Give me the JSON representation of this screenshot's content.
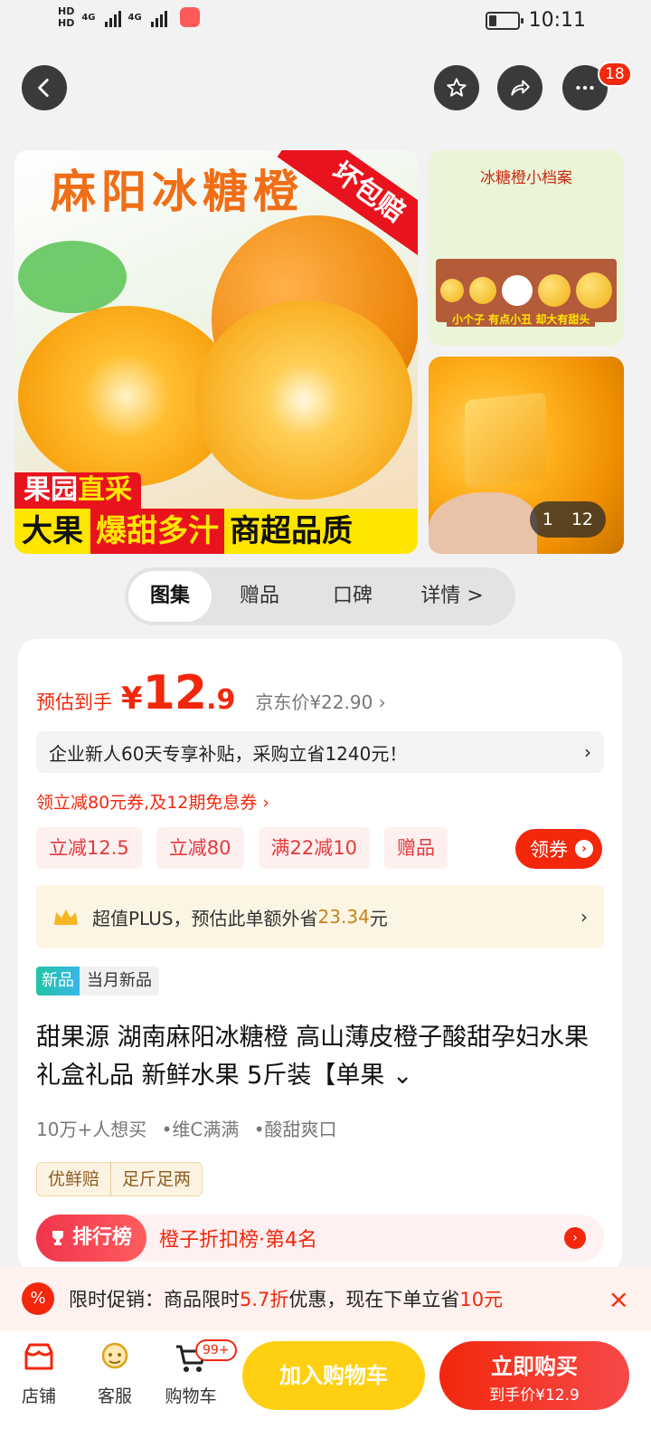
{
  "status_bar": {
    "hd1": "HD",
    "hd2": "HD",
    "net1": "4G",
    "net2": "4G",
    "time": "10:11"
  },
  "top_nav": {
    "notification_count": "18"
  },
  "gallery": {
    "main_title": "麻阳冰糖橙",
    "corner_label": "坏包赔",
    "tag_prefix": "果园",
    "tag_highlight": "直采",
    "bottom_a": "大果",
    "bottom_b": "爆甜多汁",
    "bottom_c": "商超品质",
    "side_title": "冰糖橙小档案",
    "side_caption": "小个子 有点小丑 却大有甜头",
    "page_current": "1",
    "page_total": "12"
  },
  "tabs": [
    "图集",
    "赠品",
    "口碑",
    "详情 >"
  ],
  "price": {
    "label": "预估到手",
    "symbol": "¥",
    "integer": "12",
    "decimal": ".9",
    "jd_price": "京东价¥22.90 ›"
  },
  "notice": {
    "text": "企业新人60天专享补贴，采购立省1240元！",
    "arrow": "›"
  },
  "coupon_line": "领立减80元券,及12期免息券 ›",
  "chips": [
    "立减12.5",
    "立减80",
    "满22减10",
    "赠品"
  ],
  "coupon_button": {
    "label": "领券",
    "icon": "›"
  },
  "plus": {
    "prefix": "超值PLUS，预估此单额外省",
    "amount": "23.34",
    "suffix": "元",
    "arrow": "›"
  },
  "new_tag": {
    "badge": "新品",
    "label": "当月新品"
  },
  "product_title": "甜果源 湖南麻阳冰糖橙 高山薄皮橙子酸甜孕妇水果礼盒礼品 新鲜水果 5斤装【单果 ⌄",
  "stats": [
    "10万+人想买",
    "•维C满满",
    "•酸甜爽口"
  ],
  "services": [
    "优鲜赔",
    "足斤足两"
  ],
  "rank": {
    "badge": "排行榜",
    "text": "橙子折扣榜·第4名",
    "arrow": "›"
  },
  "promo": {
    "prefix": "限时促销：商品限时",
    "discount": "5.7折",
    "middle": "优惠，现在下单立省",
    "saving": "10元",
    "close": "×"
  },
  "bottom_bar": {
    "shop": "店铺",
    "service": "客服",
    "cart": "购物车",
    "cart_badge": "99+",
    "add_to_cart": "加入购物车",
    "buy_now": "立即购买",
    "buy_sub": "到手价¥12.9"
  },
  "colors": {
    "accent": "#f2270c",
    "cart_button": "#ffd012",
    "plus_amount": "#c7841c"
  }
}
